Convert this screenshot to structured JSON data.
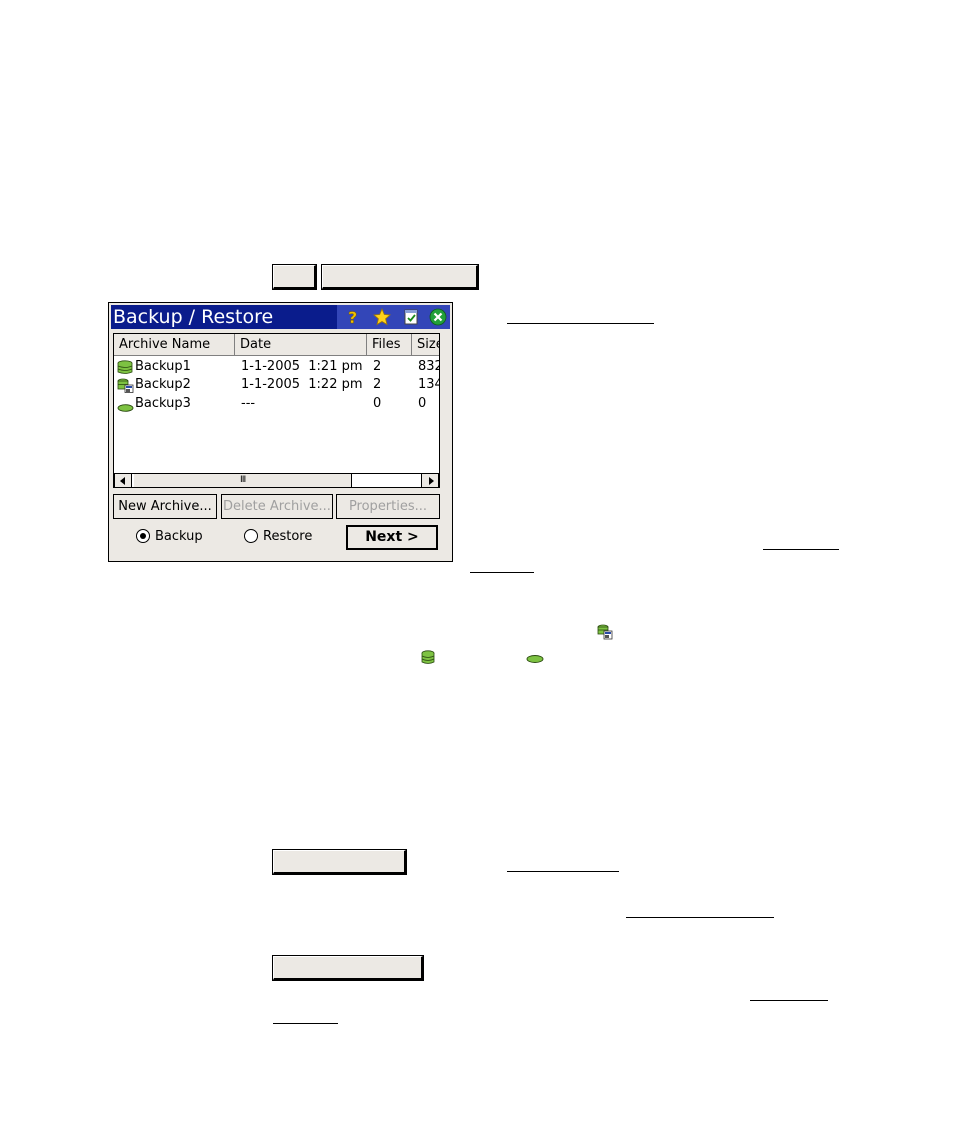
{
  "window": {
    "title": "Backup / Restore",
    "columns": [
      "Archive Name",
      "Date",
      "Files",
      "Size"
    ],
    "rows": [
      {
        "name": "Backup1",
        "date": "1-1-2005  1:21 pm",
        "files": "2",
        "size": "832",
        "icon": "database-stack-icon"
      },
      {
        "name": "Backup2",
        "date": "1-1-2005  1:22 pm",
        "files": "2",
        "size": "134",
        "icon": "database-stack-window-icon"
      },
      {
        "name": "Backup3",
        "date": "---",
        "files": "0",
        "size": "0",
        "icon": "empty-disk-icon"
      }
    ],
    "buttons": {
      "new_archive": "New Archive...",
      "delete_archive": "Delete Archive...",
      "properties": "Properties...",
      "next": "Next >"
    },
    "radios": {
      "backup": "Backup",
      "restore": "Restore",
      "selected": "Backup"
    },
    "title_icons": [
      "help-icon",
      "star-icon",
      "task-list-icon",
      "close-icon"
    ]
  },
  "colors": {
    "titlebar": "#0a1c8c",
    "titlebar_icons_bg": "#3346b8",
    "window_bg": "#ece9e4",
    "disk_green": "#7dc242"
  }
}
